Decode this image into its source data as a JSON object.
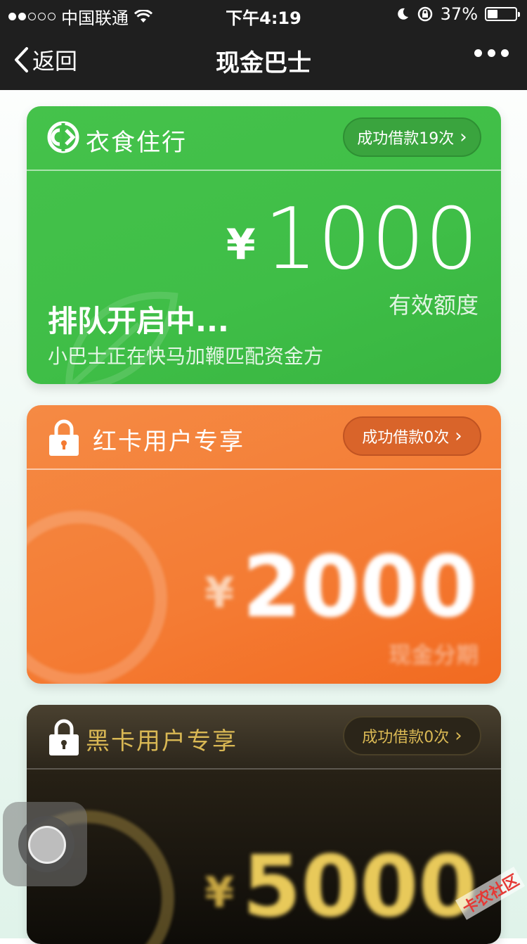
{
  "status_bar": {
    "carrier": "中国联通",
    "time": "下午4:19",
    "battery_percent_text": "37%",
    "battery_level": 0.37,
    "signal_bars_filled": 2,
    "signal_bars_total": 5
  },
  "nav": {
    "back_label": "返回",
    "title": "现金巴士"
  },
  "cards": [
    {
      "title": "衣食住行",
      "loan_count_label": "成功借款19次",
      "currency": "¥",
      "amount": "1000",
      "amount_label": "有效额度",
      "status_title": "排队开启中...",
      "status_subtitle": "小巴士正在快马加鞭匹配资金方",
      "color": "#43c04a"
    },
    {
      "title": "红卡用户专享",
      "loan_count_label": "成功借款0次",
      "currency": "¥",
      "amount": "2000",
      "amount_label": "现金分期",
      "color": "#f47b33"
    },
    {
      "title": "黑卡用户专享",
      "loan_count_label": "成功借款0次",
      "currency": "¥",
      "amount": "5000",
      "color": "#d9b854"
    }
  ],
  "watermark": "卡农社区"
}
